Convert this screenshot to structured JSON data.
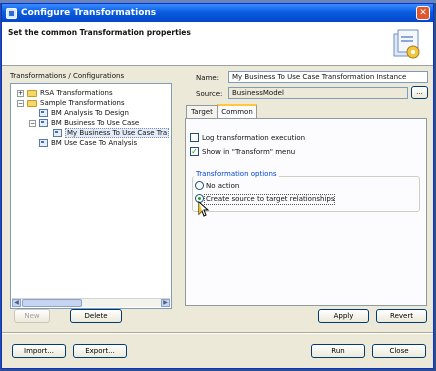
{
  "window": {
    "title": "Configure Transformations",
    "close_label": "✕"
  },
  "banner": {
    "heading": "Set the common Transformation properties",
    "icon": "wizard-banner-icon"
  },
  "tree": {
    "label": "Transformations / Configurations",
    "items": [
      {
        "text": "RSA Transformations",
        "expander": "+"
      },
      {
        "text": "Sample Transformations",
        "expander": "−"
      },
      {
        "text": "BM Analysis To Design"
      },
      {
        "text": "BM Business To Use Case",
        "expander": "−"
      },
      {
        "text": "My Business To Use Case Tra"
      },
      {
        "text": "BM Use Case To Analysis"
      }
    ]
  },
  "buttons": {
    "new": "New",
    "delete": "Delete",
    "apply": "Apply",
    "revert": "Revert",
    "import": "Import...",
    "export": "Export...",
    "run": "Run",
    "close": "Close",
    "source_browse": "..."
  },
  "form": {
    "name_label": "Name:",
    "name_value": "My Business To Use Case Transformation Instance",
    "source_label": "Source:",
    "source_value": "BusinessModel"
  },
  "tabs": [
    {
      "label": "Target",
      "active": false
    },
    {
      "label": "Common",
      "active": true
    }
  ],
  "common": {
    "log_label": "Log transformation execution",
    "log_checked": false,
    "show_label": "Show in \"Transform\" menu",
    "show_checked": true,
    "options_title": "Transformation options",
    "option_none": "No action",
    "option_create": "Create source to target relationships",
    "selected_option": "Create source to target relationships"
  },
  "colors": {
    "accent": "#0a5ce0",
    "tab_highlight": "#ffc83c",
    "check": "#21a121"
  }
}
